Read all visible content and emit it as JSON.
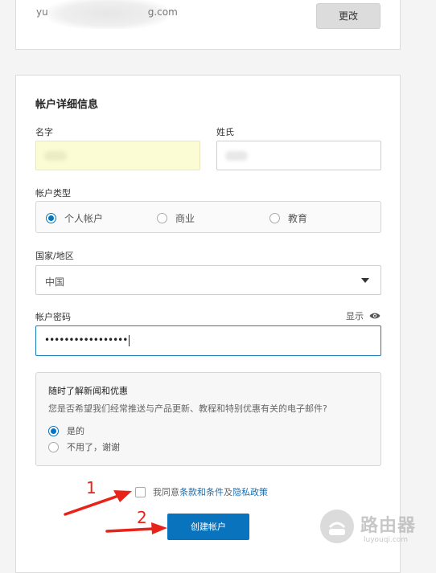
{
  "email_section": {
    "email_prefix": "yu",
    "email_suffix": "g.com",
    "change_button": "更改"
  },
  "account_details": {
    "title": "帐户详细信息",
    "first_name_label": "名字",
    "last_name_label": "姓氏",
    "account_type_label": "帐户类型",
    "account_types": [
      {
        "label": "个人帐户",
        "checked": true
      },
      {
        "label": "商业",
        "checked": false
      },
      {
        "label": "教育",
        "checked": false
      }
    ],
    "country_label": "国家/地区",
    "country_value": "中国",
    "password_label": "帐户密码",
    "show_label": "显示",
    "password_value": "•••••••••••••••••"
  },
  "newsletter": {
    "title": "随时了解新闻和优惠",
    "description": "您是否希望我们经常推送与产品更新、教程和特别优惠有关的电子邮件?",
    "options": [
      {
        "label": "是的",
        "checked": true
      },
      {
        "label": "不用了，谢谢",
        "checked": false
      }
    ]
  },
  "agreement": {
    "prefix": "我同意",
    "terms_link": "条款和条件",
    "and": "及",
    "privacy_link": "隐私政策"
  },
  "create_button": "创建帐户",
  "annotations": {
    "marker_1": "1",
    "marker_2": "2"
  },
  "watermark": {
    "title": "路由器",
    "subtitle": "luyouqi.com"
  },
  "colors": {
    "accent": "#0a73bd",
    "annotation": "#e8231a",
    "autofill": "#fbfbd4"
  }
}
